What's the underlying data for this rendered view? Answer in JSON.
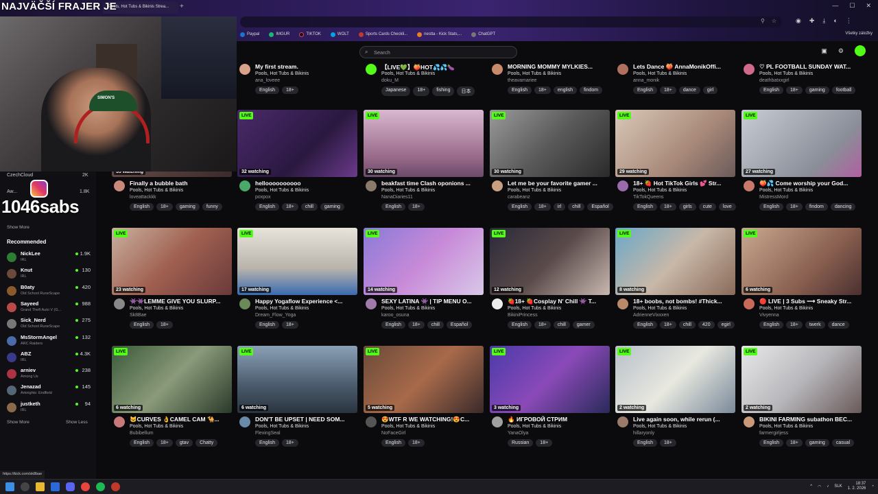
{
  "overlay": {
    "title": "NAJVÄČŠÍ FRAJER JE",
    "subs": "1046sabs"
  },
  "browser": {
    "tab_title": "Pools, Hot Tubs & Bikinis Strea...",
    "bookmarks": [
      {
        "label": "Paypal",
        "color": "#1a75d1"
      },
      {
        "label": "IMGUR",
        "color": "#1bb76e"
      },
      {
        "label": "TIKTOK",
        "color": "#111111"
      },
      {
        "label": "WOLT",
        "color": "#00a2e8"
      },
      {
        "label": "Sports Cards Checkli...",
        "color": "#c0392b"
      },
      {
        "label": "nestta - Kick Stats,...",
        "color": "#e67e22"
      },
      {
        "label": "ChatGPT",
        "color": "#777777"
      }
    ],
    "bookmarks_right": "Všetky záložky",
    "status_url": "https://kick.com/sk8bae"
  },
  "header": {
    "search_placeholder": "Search"
  },
  "sidebar": {
    "top_items": [
      {
        "name": "CzechCloud",
        "count": "2K"
      },
      {
        "name": "Aw...",
        "count": "1.8K"
      }
    ],
    "show_more": "Show More",
    "show_less": "Show Less",
    "recommended_heading": "Recommended",
    "recommended": [
      {
        "name": "NickLee",
        "game": "IRL",
        "count": "1.9K",
        "color": "#2e7d32"
      },
      {
        "name": "Knut",
        "game": "IRL",
        "count": "130",
        "color": "#6a4a3a"
      },
      {
        "name": "B0aty",
        "game": "Old School RuneScape",
        "count": "420",
        "color": "#8a5a2a"
      },
      {
        "name": "Sayeed",
        "game": "Grand Theft Auto V (G...",
        "count": "988",
        "color": "#b84a4a"
      },
      {
        "name": "Sick_Nerd",
        "game": "Old School RuneScape",
        "count": "275",
        "color": "#777777"
      },
      {
        "name": "MsStormAngel",
        "game": "ARC Raiders",
        "count": "132",
        "color": "#4a6aa8"
      },
      {
        "name": "ABZ",
        "game": "IRL",
        "count": "4.3K",
        "color": "#3a3a8a"
      },
      {
        "name": "arniev",
        "game": "Among Us",
        "count": "238",
        "color": "#aa3344"
      },
      {
        "name": "Jenazad",
        "game": "Arknights: Endfield",
        "count": "145",
        "color": "#556677"
      },
      {
        "name": "justketh",
        "game": "IRL",
        "count": "94",
        "color": "#8a6a4a"
      }
    ]
  },
  "cards": [
    {
      "title": "My first stream.",
      "category": "Pools, Hot Tubs & Bikinis",
      "user": "ana_loveee",
      "tags": [
        "English",
        "18+"
      ],
      "av": "#d9a08a"
    },
    {
      "title": "【LIVE💚】🍑HOT💦💦🍆",
      "category": "Pools, Hot Tubs & Bikinis",
      "user": "doku_M",
      "tags": [
        "Japanese",
        "18+",
        "fishing",
        "日本"
      ],
      "av": "#53fc18"
    },
    {
      "title": "MORNING MOMMY MYLKIES...",
      "category": "Pools, Hot Tubs & Bikinis",
      "user": "theavamariee",
      "tags": [
        "English",
        "18+",
        "english",
        "findom"
      ],
      "av": "#c98a6a"
    },
    {
      "title": "Lets Dance 🍑 AnnaMonikOffi...",
      "category": "Pools, Hot Tubs & Bikinis",
      "user": "anna_monik",
      "tags": [
        "English",
        "18+",
        "dance",
        "girl"
      ],
      "av": "#b07060"
    },
    {
      "title": "♡ PL FOOTBALL SUNDAY WAT...",
      "category": "Pools, Hot Tubs & Bikinis",
      "user": "deathbatxxgirl",
      "tags": [
        "English",
        "18+",
        "gaming",
        "football"
      ],
      "av": "#d06a8a"
    },
    {
      "title": "Finally a bubble bath",
      "category": "Pools, Hot Tubs & Bikinis",
      "user": "loveattackkk",
      "tags": [
        "English",
        "18+",
        "gaming",
        "funny"
      ],
      "watching": "35 watching",
      "av": "#c88a7a",
      "bg": "linear-gradient(135deg,#7a5a55,#3a2a2a)"
    },
    {
      "title": "helloooooooooo",
      "category": "Pools, Hot Tubs & Bikinis",
      "user": "poxpox",
      "tags": [
        "English",
        "18+",
        "chill",
        "gaming"
      ],
      "watching": "32 watching",
      "av": "#4aa86a",
      "bg": "linear-gradient(135deg,#4a2a6a,#2a1840 60%,#6a3a8a)"
    },
    {
      "title": "beakfast time Clash oponions ...",
      "category": "Pools, Hot Tubs & Bikinis",
      "user": "NanaDiaries11",
      "tags": [
        "English",
        "18+"
      ],
      "watching": "30 watching",
      "av": "#8a7a6a",
      "bg": "linear-gradient(180deg,#d8b8d0,#9a6a8a 70%,#6a4a6a)"
    },
    {
      "title": "Let me be your favorite gamer ...",
      "category": "Pools, Hot Tubs & Bikinis",
      "user": "carabeanz",
      "tags": [
        "English",
        "18+",
        "irl",
        "chill",
        "Español"
      ],
      "watching": "30 watching",
      "av": "#c8a080",
      "bg": "linear-gradient(135deg,#9a9a9a,#5a5a5a 50%,#2a2a2a)"
    },
    {
      "title": "18+ 🍓 Hot TikTok Girls 💕 Str...",
      "category": "Pools, Hot Tubs & Bikinis",
      "user": "TikTokQueens",
      "tags": [
        "English",
        "18+",
        "girls",
        "cute",
        "love"
      ],
      "watching": "29 watching",
      "av": "#9a6aaa",
      "bg": "linear-gradient(135deg,#d8c8b8,#a88878 60%,#6a5a5a)"
    },
    {
      "title": "🍑💦 Come worship your God...",
      "category": "Pools, Hot Tubs & Bikinis",
      "user": "MistressMord",
      "tags": [
        "English",
        "18+",
        "findom",
        "dancing"
      ],
      "watching": "27 watching",
      "av": "#c87a6a",
      "bg": "linear-gradient(135deg,#c8ccd4,#8a8e98 70%,#b060a0)"
    },
    {
      "title": "👾👾LEMME GIVE YOU SLURP...",
      "category": "Pools, Hot Tubs & Bikinis",
      "user": "Sk8Bae",
      "tags": [
        "English",
        "18+"
      ],
      "watching": "23 watching",
      "av": "#888888",
      "bg": "linear-gradient(135deg,#c8b0a0,#a06050 50%,#6a3a3a)"
    },
    {
      "title": "Happy Yogaflow Experience <...",
      "category": "Pools, Hot Tubs & Bikinis",
      "user": "Dream_Flow_Yoga",
      "tags": [
        "English",
        "18+"
      ],
      "watching": "17 watching",
      "av": "#6a8a5a",
      "bg": "linear-gradient(180deg,#e8e4dc,#b8b4ac 60%,#3a6ab0)"
    },
    {
      "title": "SEXY LATINA 👾 | TIP MENU O...",
      "category": "Pools, Hot Tubs & Bikinis",
      "user": "karoo_osuna",
      "tags": [
        "English",
        "18+",
        "chill",
        "Español"
      ],
      "watching": "14 watching",
      "av": "#a07aa8",
      "bg": "linear-gradient(135deg,#8a7ad8,#c88ad8 50%,#d8c8e8)"
    },
    {
      "title": "🍓18+ 🍓Cosplay N' Chill 👾 T...",
      "category": "Pools, Hot Tubs & Bikinis",
      "user": "BikiniPrincess",
      "tags": [
        "English",
        "18+",
        "chill",
        "gamer"
      ],
      "watching": "12 watching",
      "av": "#eeeeee",
      "bg": "linear-gradient(135deg,#2a2a3a,#5a4a4a 50%,#c8b8b0)"
    },
    {
      "title": "18+ boobs, not bombs! #Thick...",
      "category": "Pools, Hot Tubs & Bikinis",
      "user": "AdrienneVixxxen",
      "tags": [
        "English",
        "18+",
        "chill",
        "420",
        "egirl"
      ],
      "watching": "8 watching",
      "av": "#b88a6a",
      "bg": "linear-gradient(135deg,#6aa8c8,#c8b8a8 50%,#8a6a5a)"
    },
    {
      "title": "🔴 LIVE | 3 Subs ⟶ Sneaky Str...",
      "category": "Pools, Hot Tubs & Bikinis",
      "user": "Vivyenna",
      "tags": [
        "English",
        "18+",
        "twerk",
        "dance"
      ],
      "watching": "6 watching",
      "av": "#c86a5a",
      "bg": "linear-gradient(135deg,#c8a890,#8a6050 60%,#4a3030)"
    },
    {
      "title": "🐱CURVES 👌CAMEL CAM 🐪...",
      "category": "Pools, Hot Tubs & Bikinis",
      "user": "Bubibellum",
      "tags": [
        "English",
        "18+",
        "gtav",
        "Chatty"
      ],
      "watching": "6 watching",
      "av": "#c87a7a",
      "bg": "linear-gradient(135deg,#3a5a3a,#8a9a7a 50%,#2a3a2a)"
    },
    {
      "title": "DON'T BE UPSET | NEED SOM...",
      "category": "Pools, Hot Tubs & Bikinis",
      "user": "FlexingSeal",
      "tags": [
        "English",
        "18+"
      ],
      "watching": "6 watching",
      "av": "#6a8aaa",
      "bg": "linear-gradient(180deg,#8aa0b8,#4a5a6a 60%,#2a3440)"
    },
    {
      "title": "😍WTF R WE WATCHING!😍C...",
      "category": "Pools, Hot Tubs & Bikinis",
      "user": "NoFaceGirl",
      "tags": [
        "English",
        "18+"
      ],
      "watching": "5 watching",
      "av": "#555555",
      "bg": "linear-gradient(135deg,#6a4a3a,#a86a4a 50%,#3a2a2a)"
    },
    {
      "title": "🔥 ИГРОВОЙ СТРИМ",
      "category": "Pools, Hot Tubs & Bikinis",
      "user": "YanaOlya",
      "tags": [
        "Russian",
        "18+"
      ],
      "watching": "3 watching",
      "av": "#a0a0a0",
      "bg": "linear-gradient(135deg,#4a3aa8,#8a4ab8 50%,#2a2a5a)"
    },
    {
      "title": "Live again soon, while rerun (...",
      "category": "Pools, Hot Tubs & Bikinis",
      "user": "hillaryonly",
      "tags": [
        "English",
        "18+"
      ],
      "watching": "2 watching",
      "av": "#9a7a6a",
      "bg": "linear-gradient(135deg,#b8c0c8,#e8e8e0 50%,#7a8a9a)"
    },
    {
      "title": "BIKINI FARMING subathon BEC...",
      "category": "Pools, Hot Tubs & Bikinis",
      "user": "farmergirljess",
      "tags": [
        "English",
        "18+",
        "gaming",
        "casual"
      ],
      "watching": "2 watching",
      "av": "#c89a7a",
      "bg": "linear-gradient(135deg,#e8e8ea,#b8b8bc 50%,#6a5a5a)"
    }
  ],
  "live_label": "LIVE",
  "tray": {
    "lang": "SLK",
    "time": "18:37",
    "date": "1. 2. 2026"
  }
}
